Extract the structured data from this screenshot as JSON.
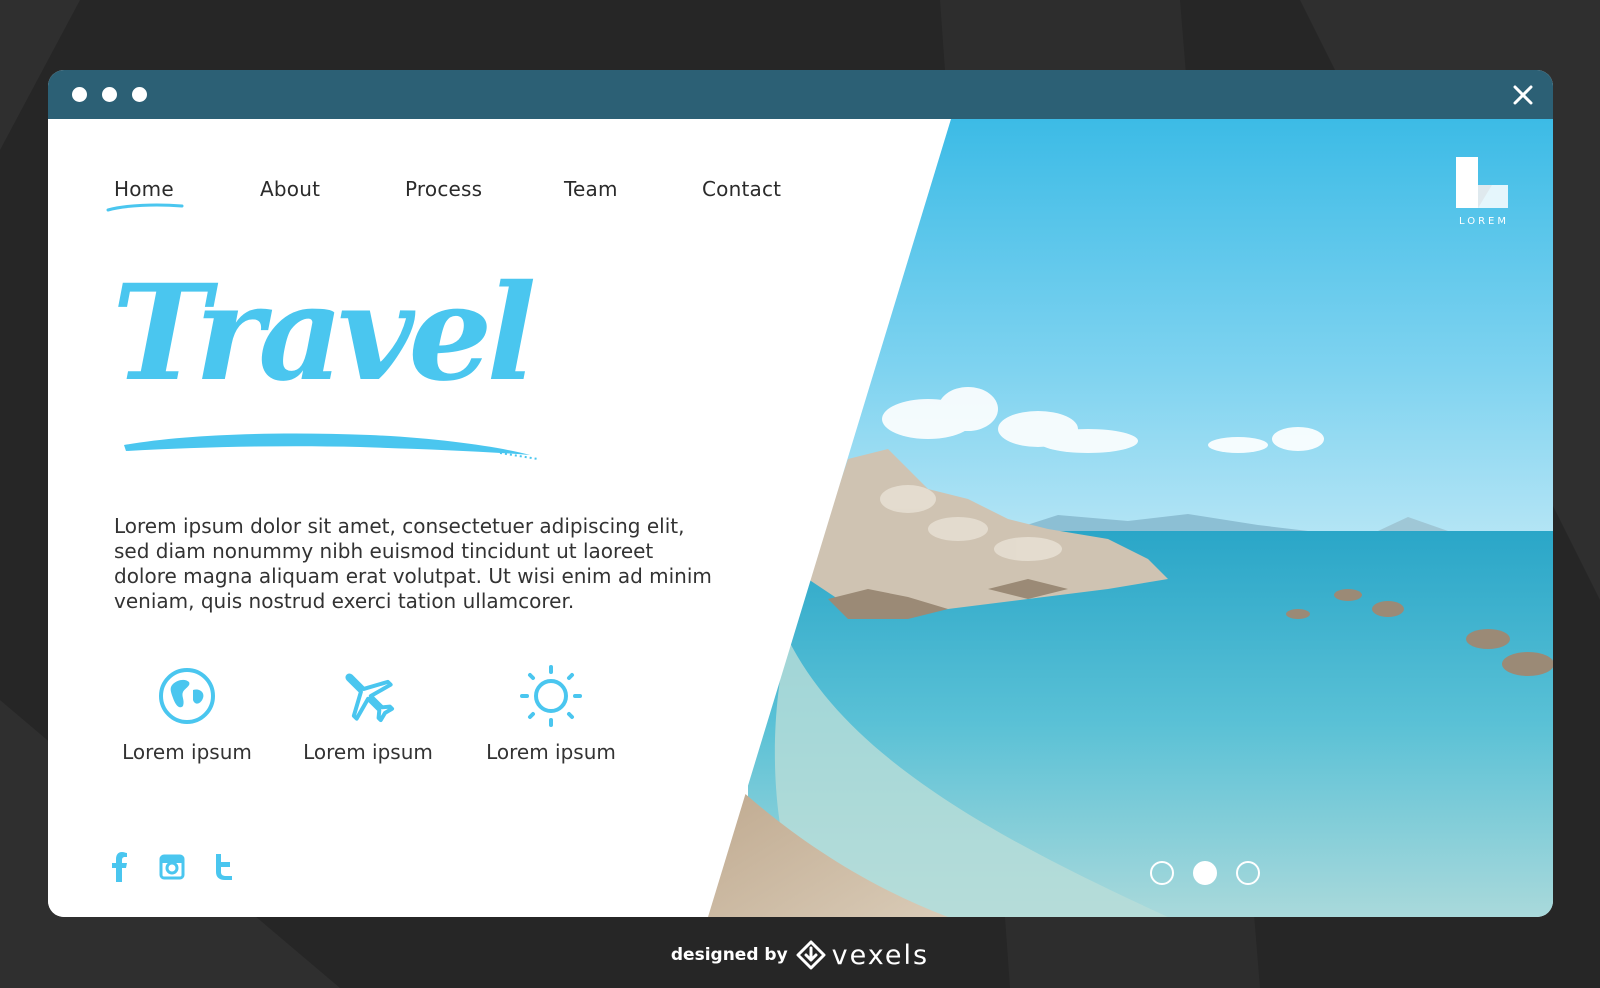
{
  "window": {
    "close_icon": "close-icon",
    "dots": [
      "dot",
      "dot",
      "dot"
    ]
  },
  "nav": {
    "items": [
      {
        "label": "Home",
        "active": true
      },
      {
        "label": "About"
      },
      {
        "label": "Process"
      },
      {
        "label": "Team"
      },
      {
        "label": "Contact"
      }
    ]
  },
  "logo": {
    "text": "LOREM"
  },
  "hero": {
    "title": "Travel",
    "description": "Lorem ipsum dolor sit amet, consectetuer adipiscing elit, sed diam nonummy nibh euismod tincidunt ut laoreet dolore magna aliquam erat volutpat. Ut wisi enim ad minim veniam, quis nostrud exerci tation ullamcorer."
  },
  "features": [
    {
      "icon": "globe-icon",
      "label": "Lorem ipsum"
    },
    {
      "icon": "airplane-icon",
      "label": "Lorem ipsum"
    },
    {
      "icon": "sun-icon",
      "label": "Lorem ipsum"
    }
  ],
  "social": [
    "facebook-icon",
    "instagram-icon",
    "twitter-icon"
  ],
  "carousel": {
    "count": 3,
    "active_index": 1
  },
  "credit": {
    "prefix": "designed by",
    "brand": "vexels"
  },
  "colors": {
    "accent": "#4ac6ef",
    "titlebar": "#2c6075",
    "background": "#262626",
    "text": "#333333"
  }
}
